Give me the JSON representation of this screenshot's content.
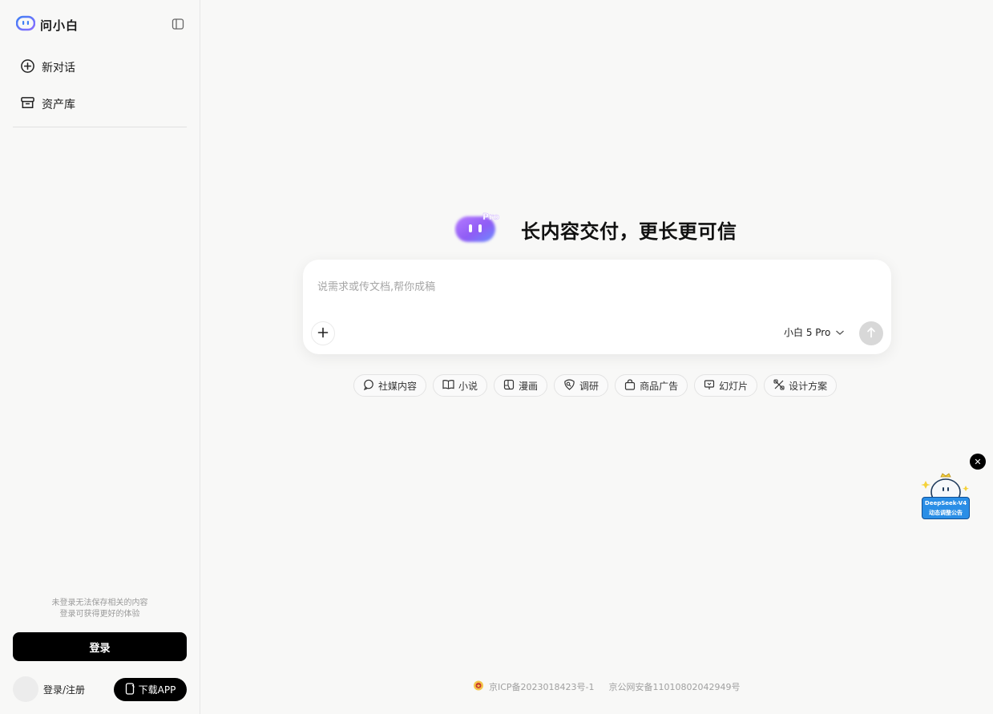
{
  "sidebar": {
    "brand": "问小白",
    "nav": [
      {
        "label": "新对话",
        "icon": "plus-circle-icon"
      },
      {
        "label": "资产库",
        "icon": "archive-box-icon"
      }
    ],
    "login_hint_1": "未登录无法保存相关的内容",
    "login_hint_2": "登录可获得更好的体验",
    "login_button": "登录",
    "user_label": "登录/注册",
    "download_button": "下载APP"
  },
  "main": {
    "hero_badge": "Pro",
    "hero_title": "长内容交付，更长更可信",
    "input_placeholder": "说需求或传文档,帮你成稿",
    "model": "小白 5 Pro",
    "chips": [
      {
        "label": "社媒内容",
        "icon": "chat-bubble-icon"
      },
      {
        "label": "小说",
        "icon": "book-icon"
      },
      {
        "label": "漫画",
        "icon": "comic-panel-icon"
      },
      {
        "label": "调研",
        "icon": "research-icon"
      },
      {
        "label": "商品广告",
        "icon": "shopping-bag-icon"
      },
      {
        "label": "幻灯片",
        "icon": "presentation-icon"
      },
      {
        "label": "设计方案",
        "icon": "design-tools-icon"
      }
    ]
  },
  "footer": {
    "icp": "京ICP备2023018423号-1",
    "police": "京公网安备11010802042949号"
  },
  "promo": {
    "line1": "DeepSeek-V4",
    "line2": "动态调整公告"
  },
  "colors": {
    "accent": "#000000",
    "brand_blue": "#3f7ff5",
    "brand_purple": "#9b6bff",
    "background": "#f8f8f7"
  }
}
